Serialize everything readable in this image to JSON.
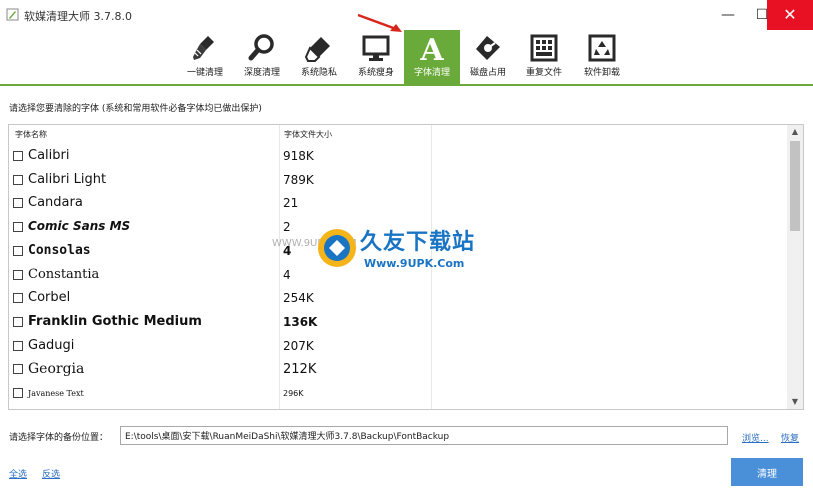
{
  "window": {
    "title": "软媒清理大师 3.7.8.0",
    "minimize": "—",
    "maximize": "☐",
    "close": "✕"
  },
  "toolbar": {
    "accent_color": "#6aaa3a",
    "items": [
      {
        "label": "一键清理",
        "icon": "broom-icon"
      },
      {
        "label": "深度清理",
        "icon": "magnifier-icon"
      },
      {
        "label": "系统隐私",
        "icon": "eraser-icon"
      },
      {
        "label": "系统瘦身",
        "icon": "monitor-icon"
      },
      {
        "label": "字体清理",
        "icon": "font-letter-icon",
        "glyph": "A"
      },
      {
        "label": "磁盘占用",
        "icon": "pie-disk-icon"
      },
      {
        "label": "重复文件",
        "icon": "grid-file-icon"
      },
      {
        "label": "软件卸载",
        "icon": "recycle-icon"
      }
    ],
    "active_index": 4
  },
  "instruction": "请选择您要清除的字体 (系统和常用软件必备字体均已做出保护)",
  "list": {
    "headers": [
      "字体名称",
      "字体文件大小"
    ],
    "rows": [
      {
        "name": "Calibri",
        "size": "918K"
      },
      {
        "name": "Calibri Light",
        "size": "789K"
      },
      {
        "name": "Candara",
        "size": "21"
      },
      {
        "name": "Comic Sans MS",
        "size": "2"
      },
      {
        "name": "Consolas",
        "size": "4"
      },
      {
        "name": "Constantia",
        "size": "4"
      },
      {
        "name": "Corbel",
        "size": "254K"
      },
      {
        "name": "Franklin Gothic Medium",
        "size": "136K"
      },
      {
        "name": "Gadugi",
        "size": "207K"
      },
      {
        "name": "Georgia",
        "size": "212K"
      },
      {
        "name": "Javanese Text",
        "size": "296K"
      }
    ],
    "scroll_up": "▲",
    "scroll_down": "▼"
  },
  "watermark": {
    "title": "久友下载站",
    "url": "Www.9UPK.Com",
    "ghost": "WWW.9UPK.COM"
  },
  "backup": {
    "label": "请选择字体的备份位置：",
    "path": "E:\\tools\\桌面\\安下载\\RuanMeiDaShi\\软媒清理大师3.7.8\\Backup\\FontBackup",
    "browse": "浏览...",
    "restore": "恢复"
  },
  "footer": {
    "select_all": "全选",
    "invert": "反选",
    "clean": "清理"
  }
}
